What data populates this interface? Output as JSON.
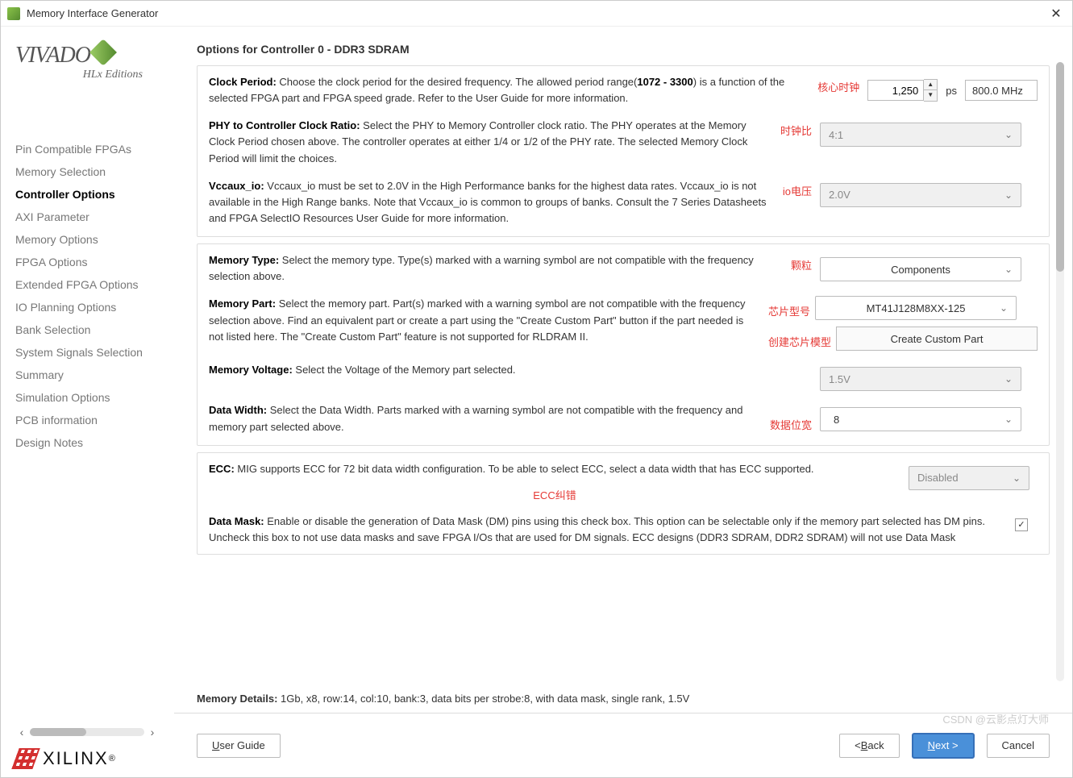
{
  "window": {
    "title": "Memory Interface Generator"
  },
  "logo": {
    "main": "VIVADO",
    "sub": "HLx Editions"
  },
  "nav": [
    "Pin Compatible FPGAs",
    "Memory Selection",
    "Controller Options",
    "AXI Parameter",
    "Memory Options",
    "FPGA Options",
    "Extended FPGA Options",
    "IO Planning Options",
    "Bank Selection",
    "System Signals Selection",
    "Summary",
    "Simulation Options",
    "PCB information",
    "Design Notes"
  ],
  "nav_active_index": 2,
  "xilinx_label": "XILINX",
  "page_title": "Options for Controller 0 - DDR3 SDRAM",
  "options": {
    "clock_period": {
      "label": "Clock Period:",
      "desc_pre": " Choose the clock period for the desired frequency. The allowed period range(",
      "range": "1072 - 3300",
      "desc_post": ") is a function of the selected FPGA part and FPGA speed grade. Refer to the User Guide for more information.",
      "value": "1,250",
      "unit": "ps",
      "freq": "800.0 MHz",
      "annot": "核心时钟"
    },
    "phy_ratio": {
      "label": "PHY to Controller Clock Ratio:",
      "desc": " Select the PHY to Memory Controller clock ratio. The PHY operates at the Memory Clock Period chosen above. The controller operates at either 1/4 or 1/2 of the PHY rate. The selected Memory Clock Period will limit the choices.",
      "value": "4:1",
      "annot": "时钟比"
    },
    "vccaux": {
      "label": "Vccaux_io:",
      "desc": " Vccaux_io must be set to 2.0V in the High Performance banks for the highest data rates. Vccaux_io is not available in the High Range banks. Note that Vccaux_io is common to groups of banks. Consult the 7 Series Datasheets and FPGA SelectIO Resources User Guide for more information.",
      "value": "2.0V",
      "annot": "io电压"
    },
    "memory_type": {
      "label": "Memory Type:",
      "desc": " Select the memory type. Type(s) marked with a warning symbol are not compatible with the frequency selection above.",
      "value": "Components",
      "annot": "颗粒"
    },
    "memory_part": {
      "label": "Memory Part:",
      "desc": " Select the memory part. Part(s) marked with a warning symbol are not compatible with the frequency selection above. Find an equivalent part or create a part using the \"Create Custom Part\" button if the part needed is not listed here. The \"Create Custom Part\" feature is not supported for RLDRAM II.",
      "value": "MT41J128M8XX-125",
      "annot": "芯片型号",
      "create_label": "Create Custom Part",
      "create_annot": "创建芯片模型"
    },
    "memory_voltage": {
      "label": "Memory Voltage:",
      "desc": " Select the Voltage of the Memory part selected.",
      "value": "1.5V"
    },
    "data_width": {
      "label": "Data Width:",
      "desc": " Select the Data Width. Parts marked with a warning symbol are not compatible with the frequency and memory part selected above.",
      "value": "8",
      "annot": "数据位宽"
    },
    "ecc": {
      "label": "ECC:",
      "desc": " MIG supports ECC for 72 bit data width configuration. To be able to select ECC, select a data width that has ECC supported.",
      "value": "Disabled",
      "annot": "ECC纠错"
    },
    "data_mask": {
      "label": "Data Mask:",
      "desc": " Enable or disable the generation of Data Mask (DM) pins using this check box. This option can be selectable only if the memory part selected has DM pins. Uncheck this box to not use data masks and save FPGA I/Os that are used for DM signals. ECC designs (DDR3 SDRAM, DDR2 SDRAM) will not use Data Mask",
      "checked": true
    }
  },
  "memory_details": {
    "label": "Memory Details:",
    "text": " 1Gb, x8, row:14, col:10, bank:3, data bits per strobe:8, with data mask, single rank, 1.5V"
  },
  "buttons": {
    "user_guide": "User Guide",
    "back": "< Back",
    "next": "Next >",
    "cancel": "Cancel"
  },
  "watermark": "CSDN @云影点灯大师"
}
